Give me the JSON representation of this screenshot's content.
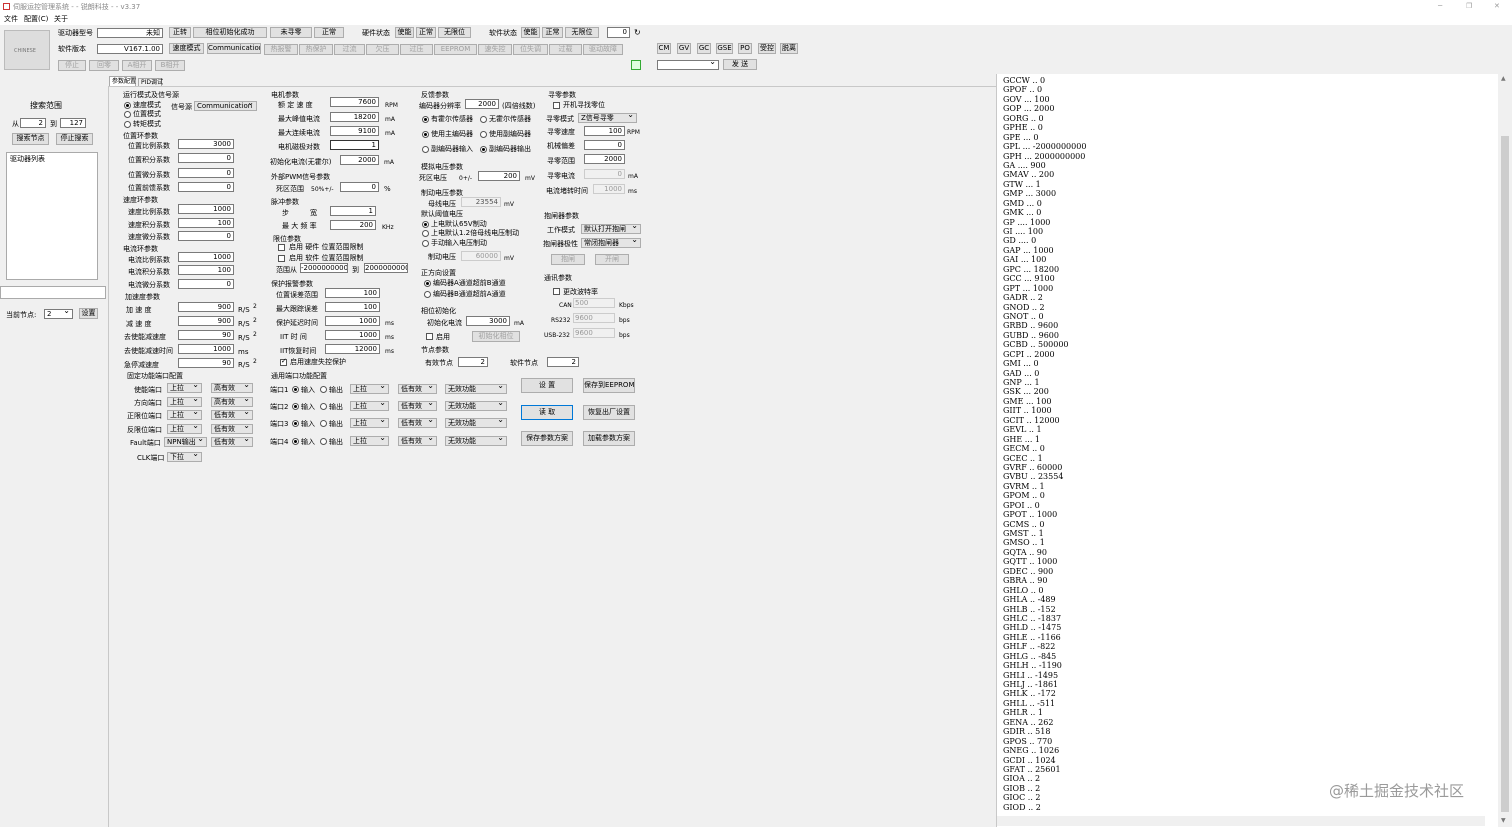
{
  "window": {
    "title": "伺服运控管理系统 - - 锐朗科技 - - v3.37",
    "min": "─",
    "max": "❐",
    "close": "✕"
  },
  "menu": [
    "文件",
    "配置(C)",
    "关于"
  ],
  "logo": "CHINESE",
  "top": {
    "drv_model_label": "驱动器型号",
    "drv_model_value": "未知",
    "sw_ver_label": "软件版本",
    "sw_ver_value": "V167.1.00",
    "btn_forward": "正转",
    "btn_phase_init": "相位初始化成功",
    "btn_no_home": "未寻零",
    "btn_normal1": "正常",
    "hw_state_label": "硬件状态",
    "hw_enable": "使能",
    "hw_normal": "正常",
    "hw_nolimit": "无限位",
    "sw_state_label": "软件状态",
    "sw_enable": "使能",
    "sw_normal": "正常",
    "sw_nolimit": "无限位",
    "counter": "0",
    "btn_speed_mode": "速度模式",
    "btn_comm": "Communication",
    "alarms": [
      "热报警",
      "热保护",
      "过流",
      "欠压",
      "过压",
      "EEPROM",
      "速失控",
      "位失调",
      "过载",
      "驱动故障"
    ],
    "btn_stop": "停止",
    "btn_home": "回零",
    "btn_a": "A相开",
    "btn_b": "B相开"
  },
  "cmd": {
    "buttons": [
      "CM",
      "GV",
      "GC",
      "GSE",
      "PO",
      "受控",
      "脱离"
    ],
    "send": "发 送"
  },
  "tabs": [
    "参数配置",
    "PID调试"
  ],
  "left": {
    "search_title": "搜索范围",
    "from": "从",
    "from_val": "2",
    "to": "到",
    "to_val": "127",
    "btn_search": "搜索节点",
    "btn_stop_search": "停止搜索",
    "list_title": "驱动器列表",
    "cur_node": "当前节点:",
    "cur_node_val": "2",
    "btn_set": "设置"
  },
  "run_mode": {
    "title": "运行模式及信号源",
    "opts": [
      "速度模式",
      "位置模式",
      "转矩模式"
    ],
    "src_label": "信号源",
    "src_val": "Communication"
  },
  "pos_loop": {
    "title": "位置环参数",
    "rows": [
      [
        "位置比例系数",
        "3000"
      ],
      [
        "位置积分系数",
        "0"
      ],
      [
        "位置微分系数",
        "0"
      ],
      [
        "位置前馈系数",
        "0"
      ]
    ]
  },
  "spd_loop": {
    "title": "速度环参数",
    "rows": [
      [
        "速度比例系数",
        "1000"
      ],
      [
        "速度积分系数",
        "100"
      ],
      [
        "速度微分系数",
        "0"
      ]
    ]
  },
  "cur_loop": {
    "title": "电流环参数",
    "rows": [
      [
        "电流比例系数",
        "1000"
      ],
      [
        "电流积分系数",
        "100"
      ],
      [
        "电流微分系数",
        "0"
      ]
    ]
  },
  "accel": {
    "title": "加速度参数",
    "rows": [
      [
        "加 速 度",
        "900",
        "R/S"
      ],
      [
        "减 速 度",
        "900",
        "R/S"
      ],
      [
        "去使能减速度",
        "90",
        "R/S"
      ],
      [
        "去使能减速时间",
        "1000",
        "ms"
      ],
      [
        "急停减速度",
        "90",
        "R/S"
      ]
    ],
    "sup": "2"
  },
  "fixed_port": {
    "title": "固定功能端口配置",
    "rows": [
      [
        "使能端口",
        "上拉",
        "高有效"
      ],
      [
        "方向端口",
        "上拉",
        "高有效"
      ],
      [
        "正限位端口",
        "上拉",
        "低有效"
      ],
      [
        "反限位端口",
        "上拉",
        "低有效"
      ],
      [
        "Fault端口",
        "NPN输出",
        "低有效"
      ],
      [
        "CLK端口",
        "下拉",
        ""
      ]
    ]
  },
  "motor": {
    "title": "电机参数",
    "rows": [
      [
        "额 定 速 度",
        "7600",
        "RPM"
      ],
      [
        "最大峰值电流",
        "18200",
        "mA"
      ],
      [
        "最大连续电流",
        "9100",
        "mA"
      ],
      [
        "电机磁极对数",
        "1",
        ""
      ]
    ],
    "init_cur_label": "初始化电流(无霍尔)",
    "init_cur_val": "2000",
    "init_cur_unit": "mA"
  },
  "pwm": {
    "title": "外部PWM信号参数",
    "dead_label": "死区范围",
    "dead_mid": "50%+/-",
    "dead_val": "0",
    "dead_unit": "%"
  },
  "pulse": {
    "title": "脉冲参数",
    "step_label": "步　　　宽",
    "step_val": "1",
    "freq_label": "最 大 频 率",
    "freq_val": "200",
    "freq_unit": "KHz"
  },
  "limit": {
    "title": "限位参数",
    "hw": "启用 硬件 位置范围限制",
    "sw": "启用 软件 位置范围限制",
    "range_label": "范围从",
    "range_from": "-2000000000",
    "range_to_label": "到",
    "range_to": "2000000000"
  },
  "protect": {
    "title": "保护报警参数",
    "rows": [
      [
        "位置误差范围",
        "100",
        ""
      ],
      [
        "最大跟踪误差",
        "100",
        ""
      ],
      [
        "保护延迟时间",
        "1000",
        "ms"
      ],
      [
        "IIT 时 间",
        "1000",
        "ms"
      ],
      [
        "IIT恢复时间",
        "12000",
        "ms"
      ]
    ],
    "enable_label": "启用速度失控保护"
  },
  "gen_port": {
    "title": "通用端口功能配置",
    "rows": [
      [
        "端口1",
        "上拉",
        "低有效",
        "无效功能"
      ],
      [
        "端口2",
        "上拉",
        "低有效",
        "无效功能"
      ],
      [
        "端口3",
        "上拉",
        "低有效",
        "无效功能"
      ],
      [
        "端口4",
        "上拉",
        "低有效",
        "无效功能"
      ]
    ],
    "in": "输入",
    "out": "输出"
  },
  "feedback": {
    "title": "反馈参数",
    "enc_label": "编码器分辨率",
    "enc_val": "2000",
    "enc_unit": "(四倍线数)",
    "hall": "有霍尔传感器",
    "nohall": "无霍尔传感器",
    "main_enc": "使用主编码器",
    "sub_enc": "使用副编码器",
    "sub_in": "副编码器输入",
    "sub_out": "副编码器输出"
  },
  "analog": {
    "title": "模拟电压参数",
    "dead_label": "死区电压",
    "dead_mid": "0+/-",
    "dead_val": "200",
    "dead_unit": "mV"
  },
  "brake": {
    "title": "制动电压参数",
    "bus_label": "母线电压",
    "bus_val": "23554",
    "bus_unit": "mV",
    "default_title": "默认阈值电压",
    "opt1": "上电默认65V制动",
    "opt2": "上电默认1.2倍母线电压制动",
    "opt3": "手动输入电压制动",
    "brake_label": "制动电压",
    "brake_val": "60000",
    "brake_unit": "mV"
  },
  "direction": {
    "title": "正方向设置",
    "opt1": "编码器A通道超前B通道",
    "opt2": "编码器B通道超前A通道"
  },
  "phase": {
    "title": "相位初始化",
    "cur_label": "初始化电流",
    "cur_val": "3000",
    "cur_unit": "mA",
    "enable": "启用",
    "btn": "初始化相位"
  },
  "node": {
    "title": "节点参数",
    "valid_label": "有效节点",
    "valid_val": "2",
    "soft_label": "软件节点",
    "soft_val": "2"
  },
  "homing": {
    "title": "寻零参数",
    "power_on": "开机寻找零位",
    "mode_label": "寻零模式",
    "mode_val": "Z信号寻零",
    "speed_label": "寻零速度",
    "speed_val": "100",
    "speed_unit": "RPM",
    "offset_label": "机械偏差",
    "offset_val": "0",
    "range_label": "寻零范围",
    "range_val": "2000",
    "cur_label": "寻零电流",
    "cur_val": "0",
    "cur_unit": "mA",
    "lock_label": "电流堵转时间",
    "lock_val": "1000",
    "lock_unit": "ms"
  },
  "holdbrake": {
    "title": "抱闸器参数",
    "mode_label": "工作模式",
    "mode_val": "默认打开抱闸",
    "pol_label": "抱闸器极性",
    "pol_val": "常闭抱闸器",
    "btn_hold": "抱闸",
    "btn_open": "开闸"
  },
  "comm": {
    "title": "通讯参数",
    "change": "更改波特率",
    "can": "CAN",
    "can_val": "500",
    "can_unit": "Kbps",
    "rs232": "RS232",
    "rs232_val": "9600",
    "rs232_unit": "bps",
    "usb": "USB-232",
    "usb_val": "9600",
    "usb_unit": "bps"
  },
  "actions": {
    "set": "设 置",
    "save_eeprom": "保存到EEPROM",
    "read": "读 取",
    "factory": "恢复出厂设置",
    "save_scheme": "保存参数方案",
    "load_scheme": "加载参数方案"
  },
  "console": [
    "GCCW .. 0",
    "GPOF .. 0",
    "GOV ... 100",
    "GOP ... 2000",
    "GORG .. 0",
    "GPHE .. 0",
    "GPE ... 0",
    "GPL ... -2000000000",
    "GPH ... 2000000000",
    "GA .... 900",
    "GMAV .. 200",
    "GTW ... 1",
    "GMP ... 3000",
    "GMD ... 0",
    "GMK ... 0",
    "GP .... 1000",
    "GI .... 100",
    "GD .... 0",
    "GAP ... 1000",
    "GAI ... 100",
    "GPC ... 18200",
    "GCC ... 9100",
    "GPT ... 1000",
    "GADR .. 2",
    "GNOD .. 2",
    "GNOT .. 0",
    "GRBD .. 9600",
    "GUBD .. 9600",
    "GCBD .. 500000",
    "GCPI .. 2000",
    "GMI ... 0",
    "GAD ... 0",
    "GNP ... 1",
    "GSK ... 200",
    "GME ... 100",
    "GIIT .. 1000",
    "GCIT .. 12000",
    "GEVL .. 1",
    "GHE ... 1",
    "GECM .. 0",
    "GCEC .. 1",
    "GVRF .. 60000",
    "GVBU .. 23554",
    "GVRM .. 1",
    "GPOM .. 0",
    "GPOI .. 0",
    "GPOT .. 1000",
    "GCMS .. 0",
    "GMST .. 1",
    "GMSO .. 1",
    "GQTA .. 90",
    "GQTT .. 1000",
    "GDEC .. 900",
    "GBRA .. 90",
    "GHLO .. 0",
    "GHLA .. -489",
    "GHLB .. -152",
    "GHLC .. -1837",
    "GHLD .. -1475",
    "GHLE .. -1166",
    "GHLF .. -822",
    "GHLG .. -845",
    "GHLH .. -1190",
    "GHLI .. -1495",
    "GHLJ .. -1861",
    "GHLK .. -172",
    "GHLL .. -511",
    "GHLR .. 1",
    "GENA .. 262",
    "GDIR .. 518",
    "GPOS .. 770",
    "GNEG .. 1026",
    "GCDI .. 1024",
    "GFAT .. 25601",
    "GIOA .. 2",
    "GIOB .. 2",
    "GIOC .. 2",
    "GIOD .. 2"
  ],
  "watermark": "@稀土掘金技术社区"
}
